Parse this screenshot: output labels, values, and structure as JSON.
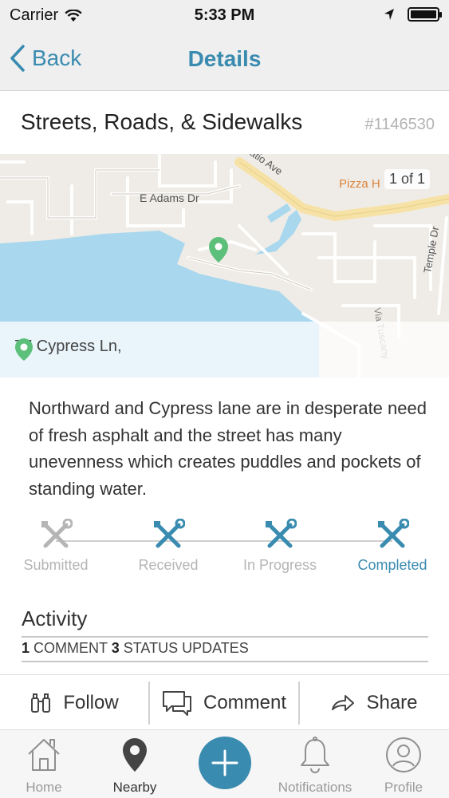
{
  "status_bar": {
    "carrier": "Carrier",
    "time": "5:33 PM"
  },
  "nav": {
    "back_label": "Back",
    "title": "Details"
  },
  "request": {
    "title": "Streets, Roads, &  Sidewalks",
    "id": "#1146530"
  },
  "map": {
    "pager": "1 of 1",
    "address": "77  Cypress Ln,",
    "streets": [
      "E Adams Dr",
      "Horatio Ave",
      "Temple Dr",
      "Via Tuscany",
      "Pizza H"
    ]
  },
  "description": "Northward and Cypress lane are in desperate need of fresh asphalt and the street has many unevenness which creates puddles and pockets of standing water.",
  "status_steps": [
    {
      "label": "Submitted",
      "state": "done"
    },
    {
      "label": "Received",
      "state": "done"
    },
    {
      "label": "In Progress",
      "state": "done"
    },
    {
      "label": "Completed",
      "state": "current"
    }
  ],
  "activity": {
    "title": "Activity",
    "comment_count": "1",
    "comment_label": "COMMENT",
    "status_count": "3",
    "status_label": "STATUS UPDATES"
  },
  "actions": {
    "follow": "Follow",
    "comment": "Comment",
    "share": "Share"
  },
  "tabs": {
    "home": "Home",
    "nearby": "Nearby",
    "notifications": "Notifications",
    "profile": "Profile"
  },
  "colors": {
    "accent": "#3a8bb0",
    "pin": "#5cbf7a",
    "water": "#a8d7ee",
    "highway": "#f6e2a6"
  }
}
